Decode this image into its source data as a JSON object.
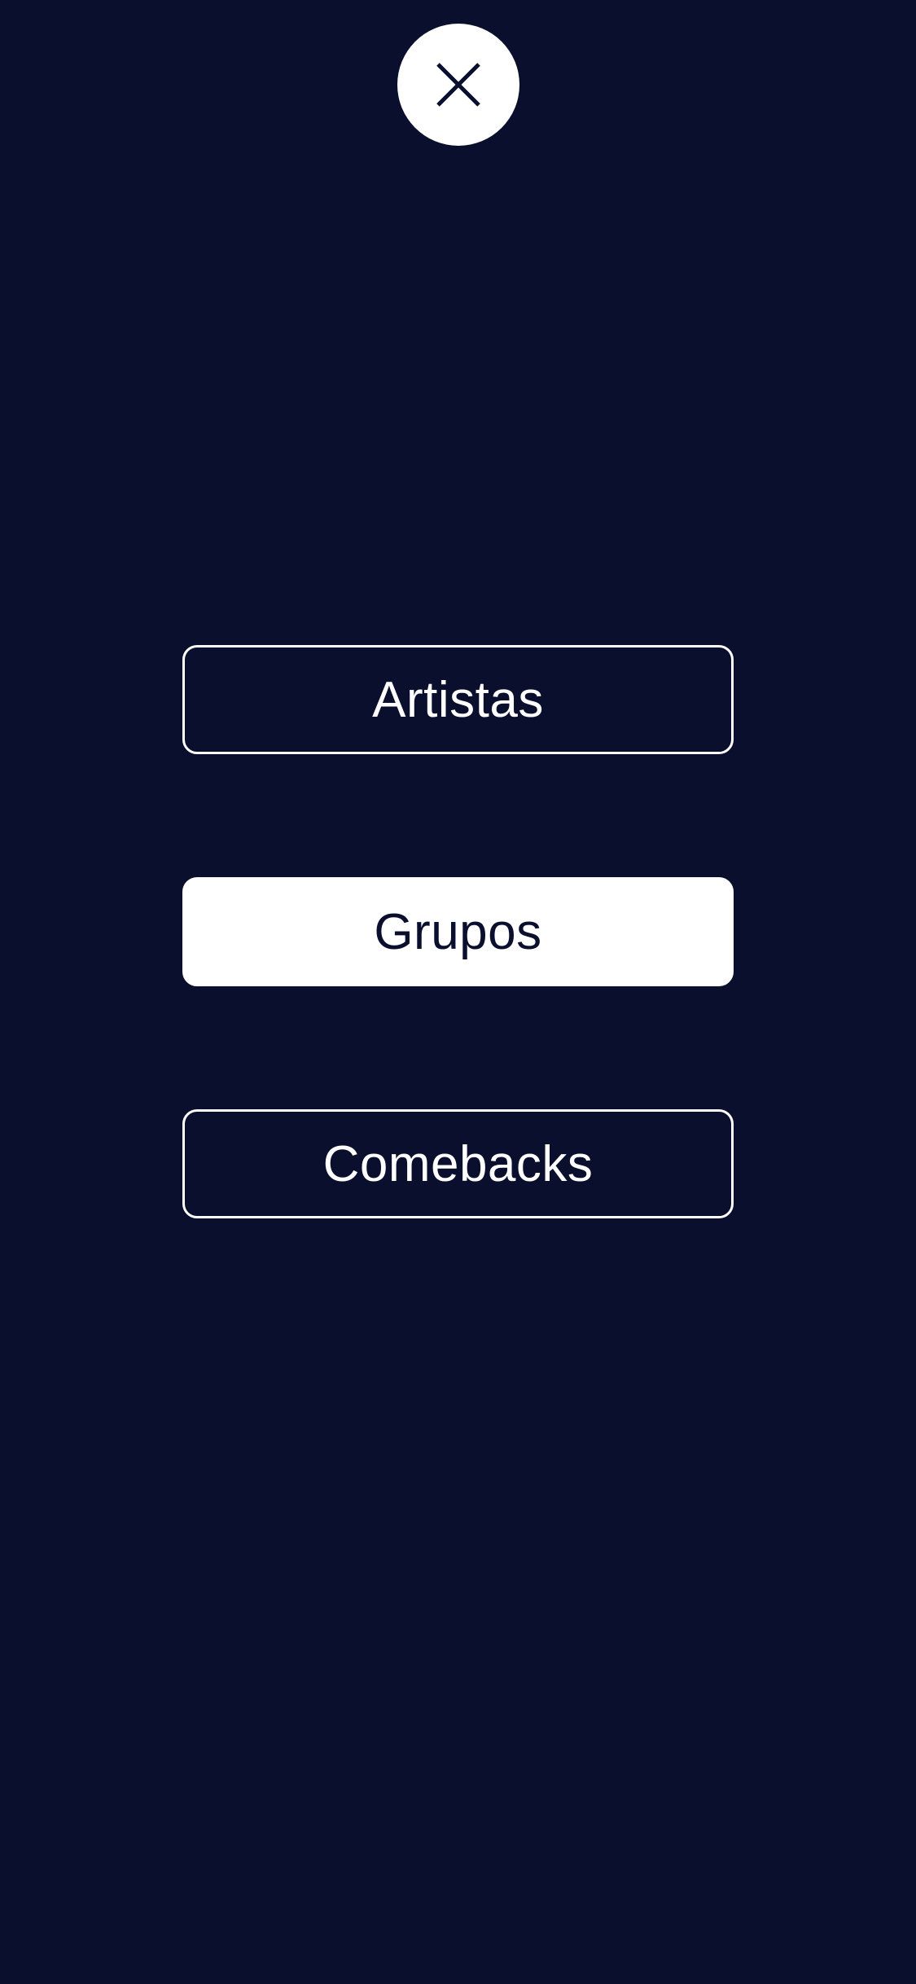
{
  "colors": {
    "background": "#0b0f2e",
    "button_light": "#ffffff",
    "button_dark_text": "#0b0f2e"
  },
  "close": {
    "icon": "close-icon"
  },
  "menu": {
    "items": [
      {
        "label": "Artistas",
        "style": "outline"
      },
      {
        "label": "Grupos",
        "style": "filled",
        "selected": true
      },
      {
        "label": "Comebacks",
        "style": "outline"
      }
    ]
  }
}
